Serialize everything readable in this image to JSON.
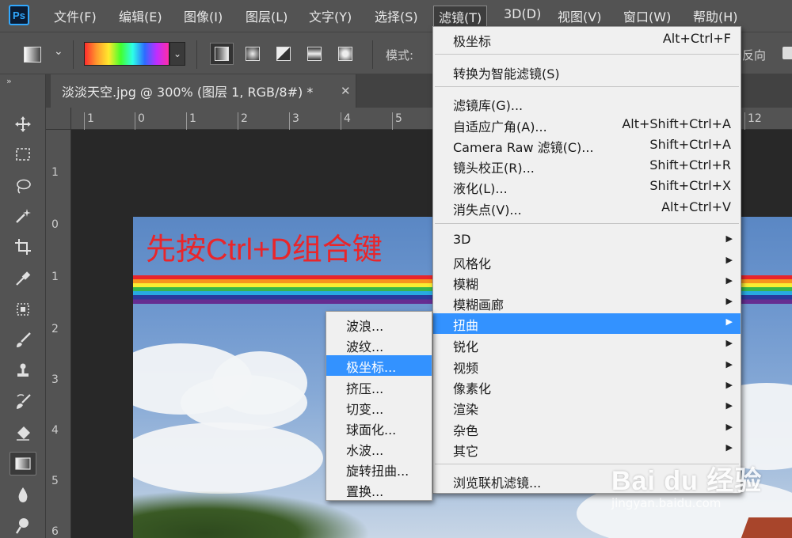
{
  "app": {
    "logo": "Ps"
  },
  "menubar": [
    {
      "label": "文件(F)"
    },
    {
      "label": "编辑(E)"
    },
    {
      "label": "图像(I)"
    },
    {
      "label": "图层(L)"
    },
    {
      "label": "文字(Y)"
    },
    {
      "label": "选择(S)"
    },
    {
      "label": "滤镜(T)"
    },
    {
      "label": "3D(D)"
    },
    {
      "label": "视图(V)"
    },
    {
      "label": "窗口(W)"
    },
    {
      "label": "帮助(H)"
    }
  ],
  "options": {
    "mode_label": "模式:",
    "reverse_label": "反向"
  },
  "toolbar": {
    "collapse": "»",
    "tools": [
      "move-tool",
      "marquee-tool",
      "lasso-tool",
      "magic-wand-tool",
      "crop-tool",
      "eyedropper-tool",
      "healing-brush-tool",
      "brush-tool",
      "clone-stamp-tool",
      "history-brush-tool",
      "eraser-tool",
      "gradient-tool",
      "blur-tool",
      "dodge-tool"
    ],
    "selected": "gradient-tool"
  },
  "document": {
    "tab_title": "淡淡天空.jpg @ 300% (图层 1, RGB/8#) *",
    "close": "✕"
  },
  "rulers": {
    "top": [
      "1",
      "0",
      "1",
      "2",
      "3",
      "4",
      "5",
      "12"
    ],
    "left": [
      "1",
      "0",
      "1",
      "2",
      "3",
      "4",
      "5",
      "6"
    ]
  },
  "canvas": {
    "overlay_text": "先按Ctrl+D组合键"
  },
  "filter_menu": {
    "items": [
      {
        "label": "极坐标",
        "shortcut": "Alt+Ctrl+F"
      },
      {
        "label": "转换为智能滤镜(S)",
        "shortcut": ""
      },
      {
        "label": "滤镜库(G)...",
        "shortcut": ""
      },
      {
        "label": "自适应广角(A)...",
        "shortcut": "Alt+Shift+Ctrl+A"
      },
      {
        "label": "Camera Raw 滤镜(C)...",
        "shortcut": "Shift+Ctrl+A"
      },
      {
        "label": "镜头校正(R)...",
        "shortcut": "Shift+Ctrl+R"
      },
      {
        "label": "液化(L)...",
        "shortcut": "Shift+Ctrl+X"
      },
      {
        "label": "消失点(V)...",
        "shortcut": "Alt+Ctrl+V"
      },
      {
        "label": "3D",
        "submenu": true
      },
      {
        "label": "风格化",
        "submenu": true
      },
      {
        "label": "模糊",
        "submenu": true
      },
      {
        "label": "模糊画廊",
        "submenu": true
      },
      {
        "label": "扭曲",
        "submenu": true,
        "highlighted": true
      },
      {
        "label": "锐化",
        "submenu": true
      },
      {
        "label": "视频",
        "submenu": true
      },
      {
        "label": "像素化",
        "submenu": true
      },
      {
        "label": "渲染",
        "submenu": true
      },
      {
        "label": "杂色",
        "submenu": true
      },
      {
        "label": "其它",
        "submenu": true
      },
      {
        "label": "浏览联机滤镜...",
        "shortcut": ""
      }
    ],
    "submenu_arrow": "▶"
  },
  "distort_submenu": {
    "items": [
      {
        "label": "波浪..."
      },
      {
        "label": "波纹..."
      },
      {
        "label": "极坐标...",
        "highlighted": true
      },
      {
        "label": "挤压..."
      },
      {
        "label": "切变..."
      },
      {
        "label": "球面化..."
      },
      {
        "label": "水波..."
      },
      {
        "label": "旋转扭曲..."
      },
      {
        "label": "置换..."
      }
    ]
  },
  "watermark": {
    "logo": "Bai du 经验",
    "url": "jingyan.baidu.com"
  },
  "colors": {
    "highlight": "#3392ff",
    "menu_bg": "#f0f0f0",
    "ui_bg": "#535353",
    "overlay_text": "#e8262b"
  }
}
